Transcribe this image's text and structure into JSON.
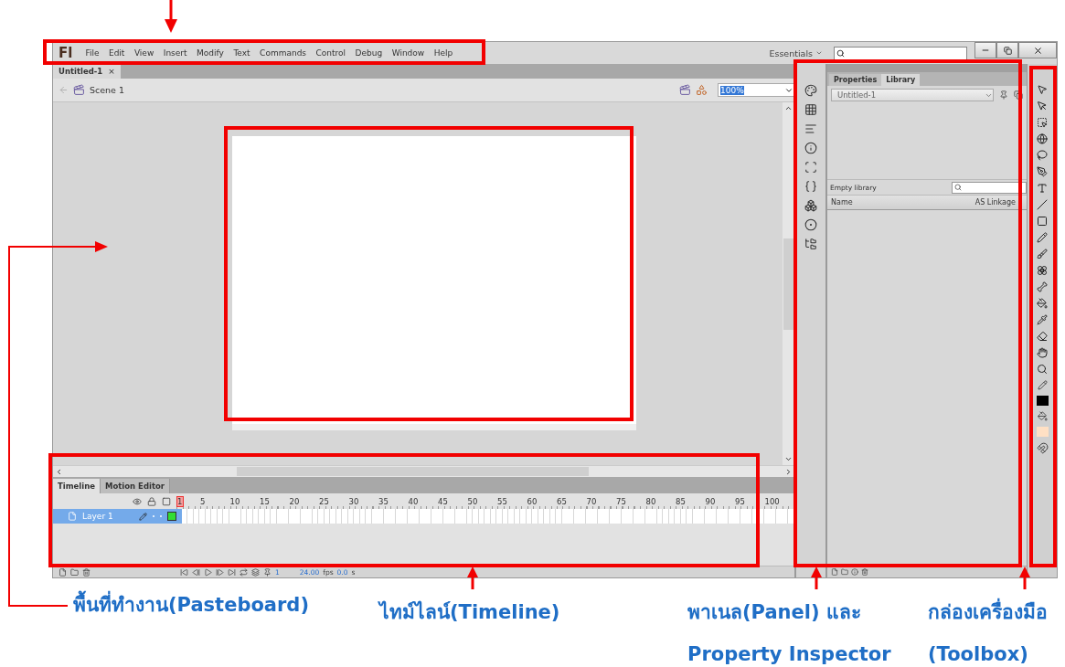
{
  "menu_bar": {
    "logo": "Fl",
    "items": [
      "File",
      "Edit",
      "View",
      "Insert",
      "Modify",
      "Text",
      "Commands",
      "Control",
      "Debug",
      "Window",
      "Help"
    ]
  },
  "workspace": {
    "label": "Essentials"
  },
  "document_tab": {
    "title": "Untitled-1",
    "close": "×"
  },
  "scene": {
    "name": "Scene 1",
    "zoom": "100%"
  },
  "timeline": {
    "tabs": [
      {
        "label": "Timeline",
        "selected": true
      },
      {
        "label": "Motion Editor",
        "selected": false
      }
    ],
    "frame_numbers": [
      "1",
      "5",
      "10",
      "15",
      "20",
      "25",
      "30",
      "35",
      "40",
      "45",
      "50",
      "55",
      "60",
      "65",
      "70",
      "75",
      "80",
      "85",
      "90",
      "95",
      "100"
    ],
    "layers": [
      {
        "name": "Layer 1",
        "selected": true,
        "color": "#33dd33"
      }
    ],
    "status": {
      "frame": "1",
      "fps": "24.00",
      "fps_unit": "fps",
      "time": "0.0",
      "time_unit": "s"
    }
  },
  "panel": {
    "tabs": [
      {
        "label": "Properties",
        "selected": false
      },
      {
        "label": "Library",
        "selected": true
      }
    ],
    "document": "Untitled-1",
    "status": "Empty library",
    "columns": [
      "Name",
      "AS Linkage"
    ]
  },
  "toolbox": {
    "swatches": [
      {
        "kind": "stroke",
        "color": "#000000"
      },
      {
        "kind": "fill",
        "color": "#ffe0c4"
      }
    ]
  },
  "annotations": [
    {
      "lines": [
        "พื้นที่ทำงาน(Pasteboard)"
      ]
    },
    {
      "lines": [
        "ไทม์ไลน์(Timeline)"
      ]
    },
    {
      "lines": [
        "พาเนล(Panel) และ",
        "Property Inspector"
      ]
    },
    {
      "lines": [
        "กล่องเครื่องมือ",
        "(Toolbox)"
      ]
    }
  ]
}
